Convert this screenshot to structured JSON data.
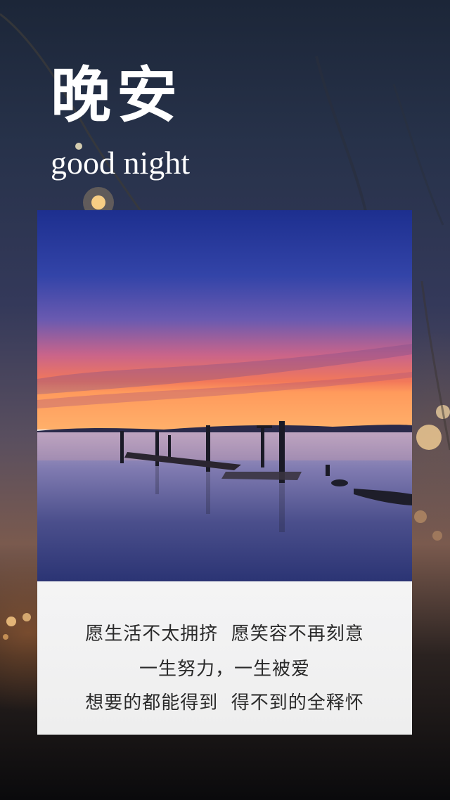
{
  "header": {
    "title_cn": "晚安",
    "title_en": "good night"
  },
  "card": {
    "photo_description_icon": "sunset-pier-photo",
    "lines": [
      "愿生活不太拥挤  愿笑容不再刻意",
      "一生努力，一生被爱",
      "想要的都能得到  得不到的全释怀"
    ]
  },
  "colors": {
    "title": "#ffffff",
    "text": "#2a2a2a",
    "panel": "#f2f2f2"
  }
}
